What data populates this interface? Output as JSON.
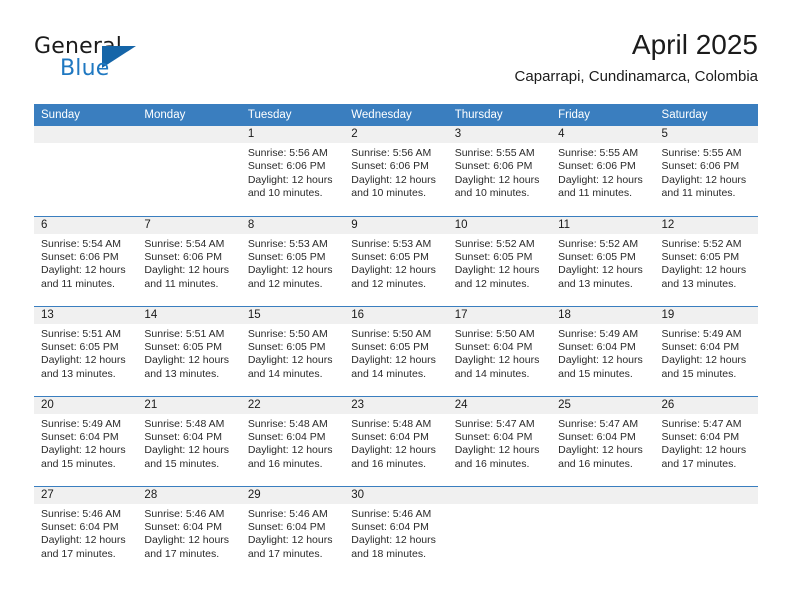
{
  "brand": {
    "word_one": "General",
    "word_two": "Blue",
    "logo_icon": "triangle-logo-icon",
    "accent_color": "#1f78c1",
    "triangle_color": "#1565a8"
  },
  "header": {
    "month_title": "April 2025",
    "location": "Caparrapi, Cundinamarca, Colombia"
  },
  "calendar": {
    "header_color": "#3a7ebf",
    "daynum_band_color": "#f0f0f0",
    "weekdays": [
      "Sunday",
      "Monday",
      "Tuesday",
      "Wednesday",
      "Thursday",
      "Friday",
      "Saturday"
    ],
    "weeks": [
      [
        {
          "day": "",
          "sunrise": "",
          "sunset": "",
          "daylight_line1": "",
          "daylight_line2": ""
        },
        {
          "day": "",
          "sunrise": "",
          "sunset": "",
          "daylight_line1": "",
          "daylight_line2": ""
        },
        {
          "day": "1",
          "sunrise": "Sunrise: 5:56 AM",
          "sunset": "Sunset: 6:06 PM",
          "daylight_line1": "Daylight: 12 hours",
          "daylight_line2": "and 10 minutes."
        },
        {
          "day": "2",
          "sunrise": "Sunrise: 5:56 AM",
          "sunset": "Sunset: 6:06 PM",
          "daylight_line1": "Daylight: 12 hours",
          "daylight_line2": "and 10 minutes."
        },
        {
          "day": "3",
          "sunrise": "Sunrise: 5:55 AM",
          "sunset": "Sunset: 6:06 PM",
          "daylight_line1": "Daylight: 12 hours",
          "daylight_line2": "and 10 minutes."
        },
        {
          "day": "4",
          "sunrise": "Sunrise: 5:55 AM",
          "sunset": "Sunset: 6:06 PM",
          "daylight_line1": "Daylight: 12 hours",
          "daylight_line2": "and 11 minutes."
        },
        {
          "day": "5",
          "sunrise": "Sunrise: 5:55 AM",
          "sunset": "Sunset: 6:06 PM",
          "daylight_line1": "Daylight: 12 hours",
          "daylight_line2": "and 11 minutes."
        }
      ],
      [
        {
          "day": "6",
          "sunrise": "Sunrise: 5:54 AM",
          "sunset": "Sunset: 6:06 PM",
          "daylight_line1": "Daylight: 12 hours",
          "daylight_line2": "and 11 minutes."
        },
        {
          "day": "7",
          "sunrise": "Sunrise: 5:54 AM",
          "sunset": "Sunset: 6:06 PM",
          "daylight_line1": "Daylight: 12 hours",
          "daylight_line2": "and 11 minutes."
        },
        {
          "day": "8",
          "sunrise": "Sunrise: 5:53 AM",
          "sunset": "Sunset: 6:05 PM",
          "daylight_line1": "Daylight: 12 hours",
          "daylight_line2": "and 12 minutes."
        },
        {
          "day": "9",
          "sunrise": "Sunrise: 5:53 AM",
          "sunset": "Sunset: 6:05 PM",
          "daylight_line1": "Daylight: 12 hours",
          "daylight_line2": "and 12 minutes."
        },
        {
          "day": "10",
          "sunrise": "Sunrise: 5:52 AM",
          "sunset": "Sunset: 6:05 PM",
          "daylight_line1": "Daylight: 12 hours",
          "daylight_line2": "and 12 minutes."
        },
        {
          "day": "11",
          "sunrise": "Sunrise: 5:52 AM",
          "sunset": "Sunset: 6:05 PM",
          "daylight_line1": "Daylight: 12 hours",
          "daylight_line2": "and 13 minutes."
        },
        {
          "day": "12",
          "sunrise": "Sunrise: 5:52 AM",
          "sunset": "Sunset: 6:05 PM",
          "daylight_line1": "Daylight: 12 hours",
          "daylight_line2": "and 13 minutes."
        }
      ],
      [
        {
          "day": "13",
          "sunrise": "Sunrise: 5:51 AM",
          "sunset": "Sunset: 6:05 PM",
          "daylight_line1": "Daylight: 12 hours",
          "daylight_line2": "and 13 minutes."
        },
        {
          "day": "14",
          "sunrise": "Sunrise: 5:51 AM",
          "sunset": "Sunset: 6:05 PM",
          "daylight_line1": "Daylight: 12 hours",
          "daylight_line2": "and 13 minutes."
        },
        {
          "day": "15",
          "sunrise": "Sunrise: 5:50 AM",
          "sunset": "Sunset: 6:05 PM",
          "daylight_line1": "Daylight: 12 hours",
          "daylight_line2": "and 14 minutes."
        },
        {
          "day": "16",
          "sunrise": "Sunrise: 5:50 AM",
          "sunset": "Sunset: 6:05 PM",
          "daylight_line1": "Daylight: 12 hours",
          "daylight_line2": "and 14 minutes."
        },
        {
          "day": "17",
          "sunrise": "Sunrise: 5:50 AM",
          "sunset": "Sunset: 6:04 PM",
          "daylight_line1": "Daylight: 12 hours",
          "daylight_line2": "and 14 minutes."
        },
        {
          "day": "18",
          "sunrise": "Sunrise: 5:49 AM",
          "sunset": "Sunset: 6:04 PM",
          "daylight_line1": "Daylight: 12 hours",
          "daylight_line2": "and 15 minutes."
        },
        {
          "day": "19",
          "sunrise": "Sunrise: 5:49 AM",
          "sunset": "Sunset: 6:04 PM",
          "daylight_line1": "Daylight: 12 hours",
          "daylight_line2": "and 15 minutes."
        }
      ],
      [
        {
          "day": "20",
          "sunrise": "Sunrise: 5:49 AM",
          "sunset": "Sunset: 6:04 PM",
          "daylight_line1": "Daylight: 12 hours",
          "daylight_line2": "and 15 minutes."
        },
        {
          "day": "21",
          "sunrise": "Sunrise: 5:48 AM",
          "sunset": "Sunset: 6:04 PM",
          "daylight_line1": "Daylight: 12 hours",
          "daylight_line2": "and 15 minutes."
        },
        {
          "day": "22",
          "sunrise": "Sunrise: 5:48 AM",
          "sunset": "Sunset: 6:04 PM",
          "daylight_line1": "Daylight: 12 hours",
          "daylight_line2": "and 16 minutes."
        },
        {
          "day": "23",
          "sunrise": "Sunrise: 5:48 AM",
          "sunset": "Sunset: 6:04 PM",
          "daylight_line1": "Daylight: 12 hours",
          "daylight_line2": "and 16 minutes."
        },
        {
          "day": "24",
          "sunrise": "Sunrise: 5:47 AM",
          "sunset": "Sunset: 6:04 PM",
          "daylight_line1": "Daylight: 12 hours",
          "daylight_line2": "and 16 minutes."
        },
        {
          "day": "25",
          "sunrise": "Sunrise: 5:47 AM",
          "sunset": "Sunset: 6:04 PM",
          "daylight_line1": "Daylight: 12 hours",
          "daylight_line2": "and 16 minutes."
        },
        {
          "day": "26",
          "sunrise": "Sunrise: 5:47 AM",
          "sunset": "Sunset: 6:04 PM",
          "daylight_line1": "Daylight: 12 hours",
          "daylight_line2": "and 17 minutes."
        }
      ],
      [
        {
          "day": "27",
          "sunrise": "Sunrise: 5:46 AM",
          "sunset": "Sunset: 6:04 PM",
          "daylight_line1": "Daylight: 12 hours",
          "daylight_line2": "and 17 minutes."
        },
        {
          "day": "28",
          "sunrise": "Sunrise: 5:46 AM",
          "sunset": "Sunset: 6:04 PM",
          "daylight_line1": "Daylight: 12 hours",
          "daylight_line2": "and 17 minutes."
        },
        {
          "day": "29",
          "sunrise": "Sunrise: 5:46 AM",
          "sunset": "Sunset: 6:04 PM",
          "daylight_line1": "Daylight: 12 hours",
          "daylight_line2": "and 17 minutes."
        },
        {
          "day": "30",
          "sunrise": "Sunrise: 5:46 AM",
          "sunset": "Sunset: 6:04 PM",
          "daylight_line1": "Daylight: 12 hours",
          "daylight_line2": "and 18 minutes."
        },
        {
          "day": "",
          "sunrise": "",
          "sunset": "",
          "daylight_line1": "",
          "daylight_line2": ""
        },
        {
          "day": "",
          "sunrise": "",
          "sunset": "",
          "daylight_line1": "",
          "daylight_line2": ""
        },
        {
          "day": "",
          "sunrise": "",
          "sunset": "",
          "daylight_line1": "",
          "daylight_line2": ""
        }
      ]
    ]
  }
}
